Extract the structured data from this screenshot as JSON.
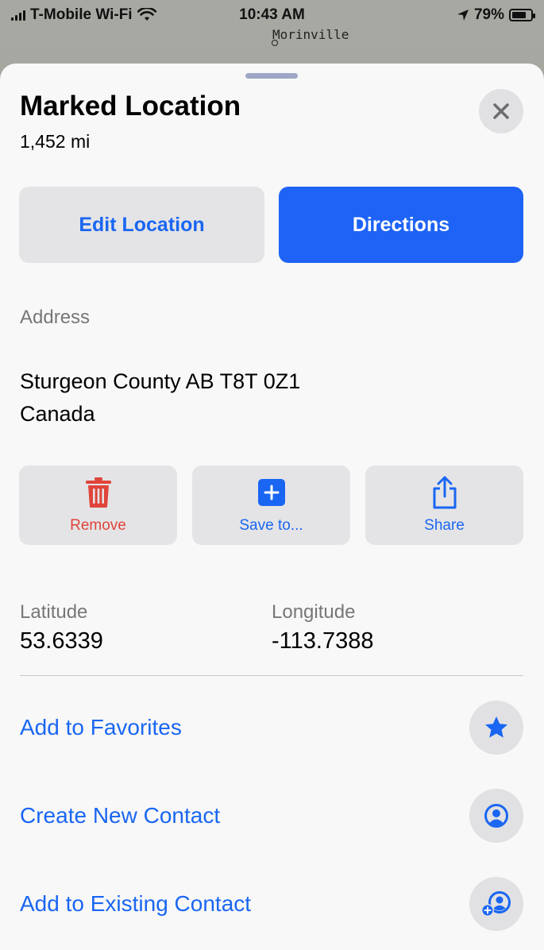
{
  "status_bar": {
    "carrier": "T-Mobile Wi-Fi",
    "time": "10:43 AM",
    "battery": "79%",
    "battery_level": 0.79
  },
  "map": {
    "place_label": "Morinville"
  },
  "sheet": {
    "title": "Marked Location",
    "distance": "1,452 mi",
    "close_icon": "close-icon"
  },
  "primary_buttons": {
    "edit_label": "Edit Location",
    "directions_label": "Directions"
  },
  "address": {
    "label": "Address",
    "line1": "Sturgeon County AB T8T 0Z1",
    "line2": "Canada"
  },
  "actions": [
    {
      "label": "Remove",
      "icon": "trash-icon",
      "color": "#e0443a"
    },
    {
      "label": "Save to...",
      "icon": "add-square-icon",
      "color": "#1a66f2"
    },
    {
      "label": "Share",
      "icon": "share-icon",
      "color": "#1a66f2"
    }
  ],
  "coordinates": {
    "latitude_label": "Latitude",
    "latitude_value": "53.6339",
    "longitude_label": "Longitude",
    "longitude_value": "-113.7388"
  },
  "list": [
    {
      "label": "Add to Favorites",
      "icon": "star-icon"
    },
    {
      "label": "Create New Contact",
      "icon": "contact-icon"
    },
    {
      "label": "Add to Existing Contact",
      "icon": "add-contact-icon"
    }
  ],
  "colors": {
    "accent": "#1a66f2",
    "directions_bg": "#1e63f5",
    "destructive": "#e0443a"
  }
}
